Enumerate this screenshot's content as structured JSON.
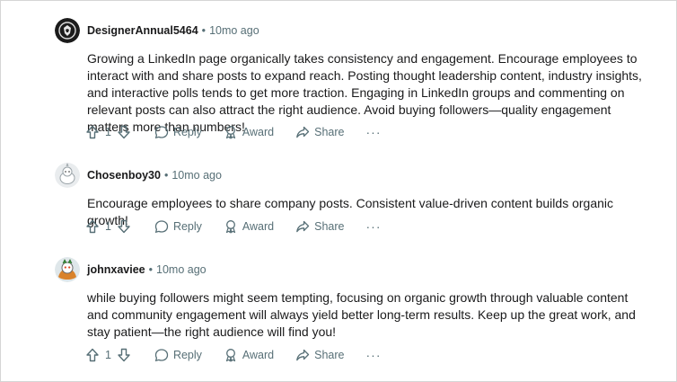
{
  "comments": [
    {
      "author": "DesignerAnnual5464",
      "time": "10mo ago",
      "body": "Growing a LinkedIn page organically takes consistency and engagement. Encourage employees to interact with and share posts to expand reach. Posting thought leadership content, industry insights, and interactive polls tends to get more traction. Engaging in LinkedIn groups and commenting on relevant posts can also attract the right audience. Avoid buying followers—quality engagement matters more than numbers!",
      "votes": "1"
    },
    {
      "author": "Chosenboy30",
      "time": "10mo ago",
      "body": "Encourage employees to share company posts. Consistent value-driven content builds organic growth!",
      "votes": "1"
    },
    {
      "author": "johnxaviee",
      "time": "10mo ago",
      "body": "while buying followers might seem tempting, focusing on organic growth through valuable content and community engagement will always yield better long-term results. Keep up the great work, and stay patient—the right audience will find you!",
      "votes": "1"
    }
  ],
  "labels": {
    "separator": "•",
    "reply": "Reply",
    "award": "Award",
    "share": "Share",
    "more": "···"
  },
  "icons": {
    "upvote": "upvote-arrow-icon",
    "downvote": "downvote-arrow-icon",
    "reply": "speech-bubble-icon",
    "award": "award-medal-icon",
    "share": "share-arrow-icon",
    "more": "ellipsis-icon"
  },
  "colors": {
    "meta": "#576f76",
    "text": "#1a1a1b"
  }
}
